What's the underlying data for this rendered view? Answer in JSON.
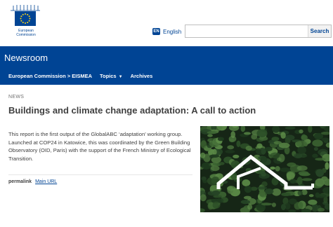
{
  "header": {
    "logo_text_line1": "European",
    "logo_text_line2": "Commission",
    "language_code": "EN",
    "language_label": "English",
    "search_placeholder": "",
    "search_button": "Search"
  },
  "banner": {
    "title": "Newsroom",
    "nav": {
      "breadcrumb": "European Commission > EISMEA",
      "topics": "Topics",
      "archives": "Archives"
    }
  },
  "article": {
    "kicker": "NEWS",
    "title": "Buildings and climate change adaptation: A call to action",
    "body": "This report is the first output of the GlobalABC ‘adaptation’ working group. Launched at COP24 in Katowice, this was coordinated by the Green Building Observatory (OID, Paris) with the support of the French Ministry of Ecological Transition.",
    "permalink_label": "permalink",
    "main_url_label": "Main URL"
  },
  "colors": {
    "brand_blue": "#004494",
    "eu_gold": "#ffd617",
    "leaf_dark": "#1f3b1f",
    "leaf_light": "#4f7a3f"
  }
}
